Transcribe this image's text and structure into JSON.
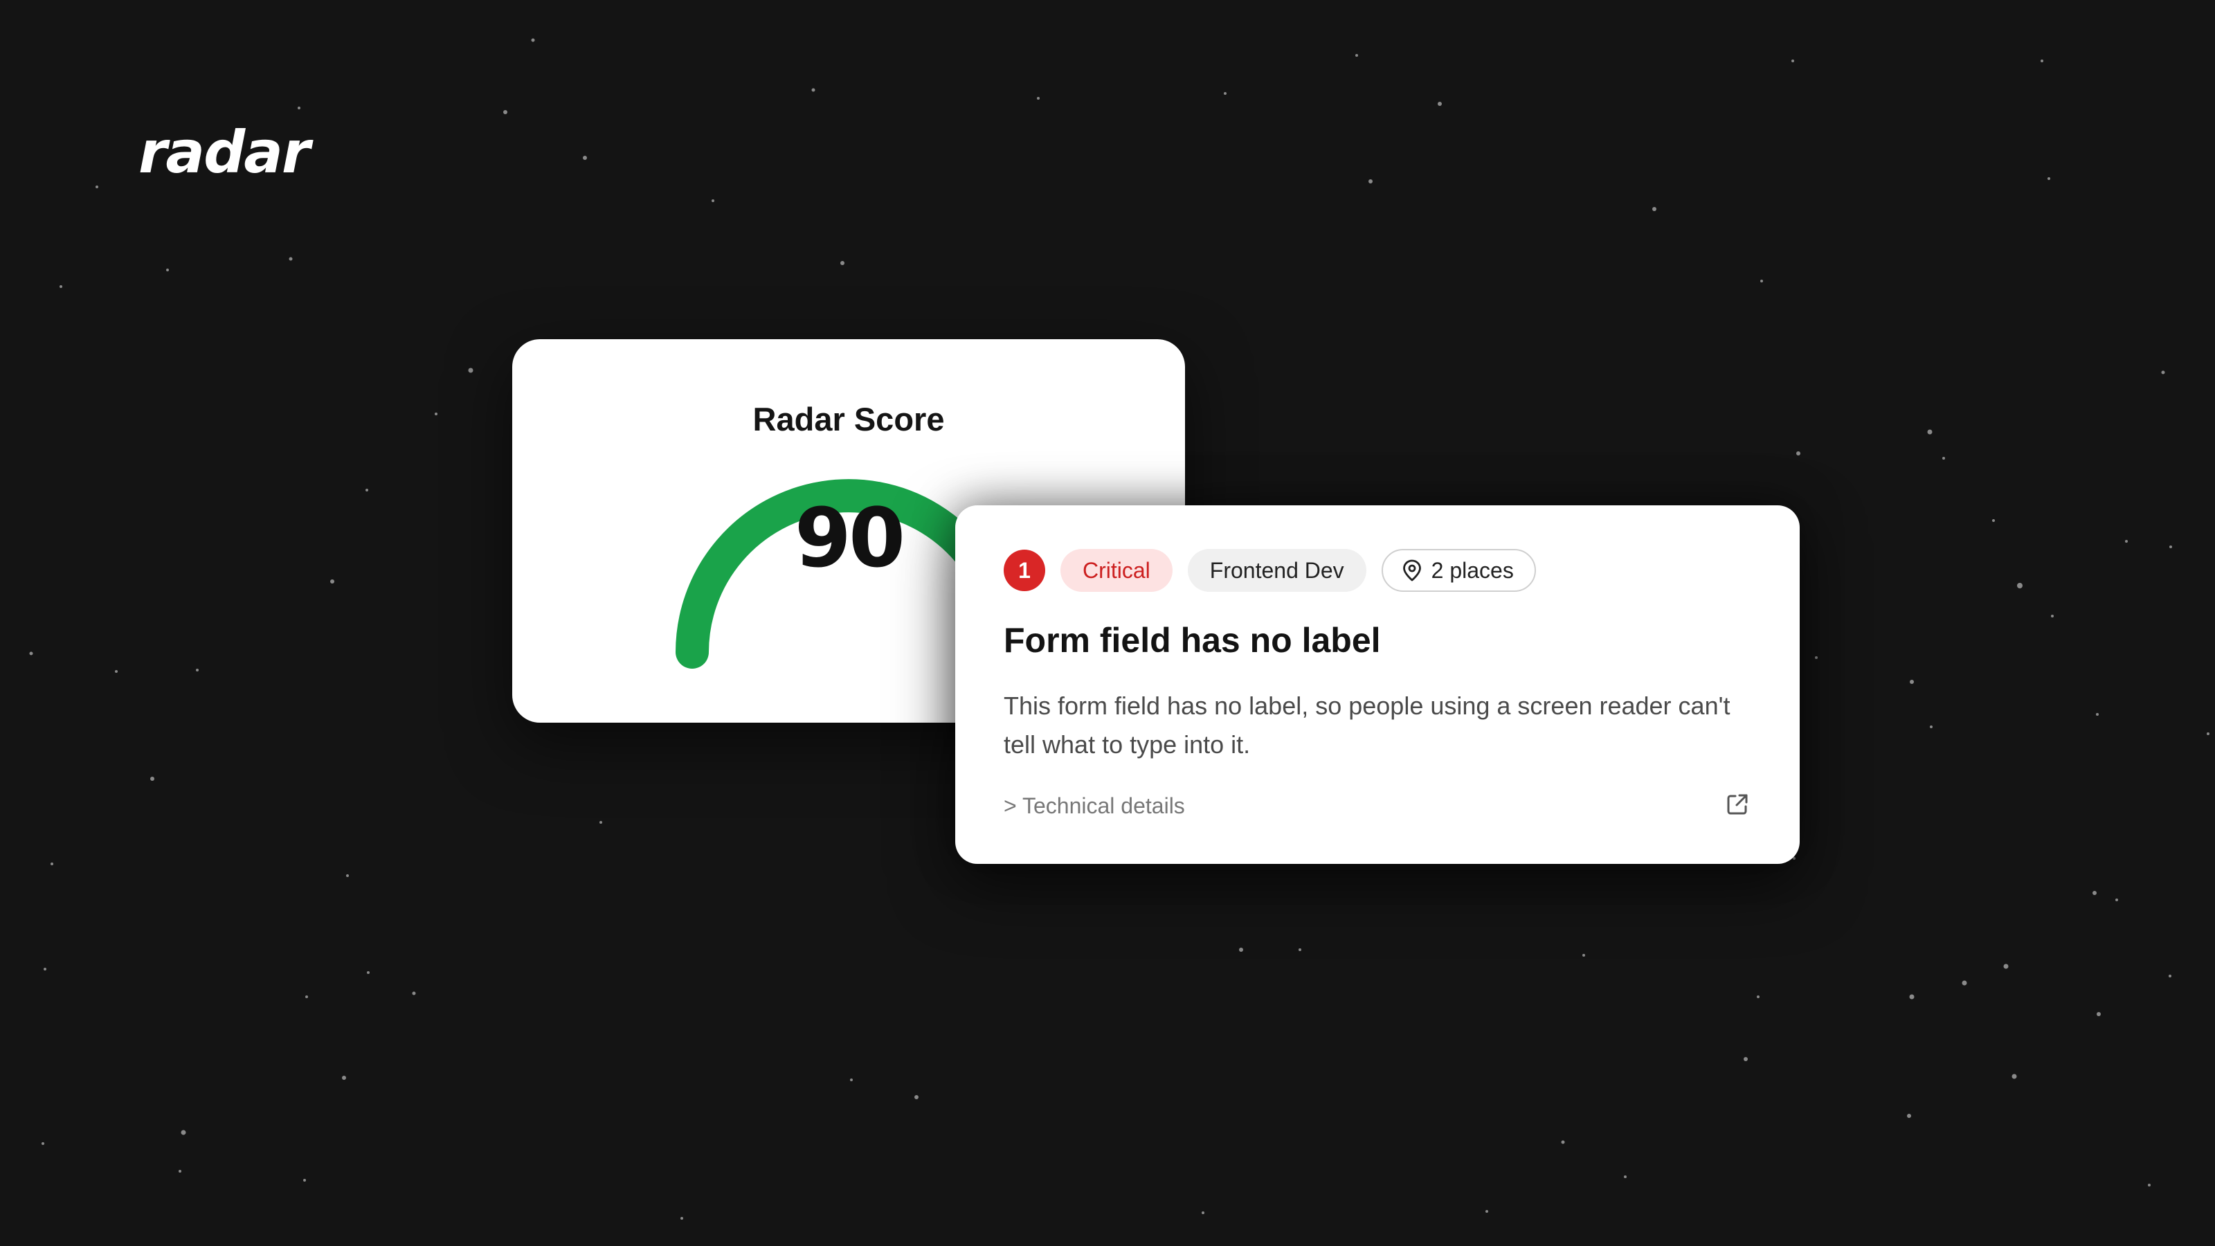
{
  "brand": {
    "logo_text": "radar"
  },
  "score_card": {
    "title": "Radar Score",
    "score": "90",
    "score_value": 90,
    "score_max": 100,
    "gauge_color": "#1aa34a"
  },
  "issue_card": {
    "count": "1",
    "severity": "Critical",
    "team": "Frontend Dev",
    "places": "2 places",
    "title": "Form field has no label",
    "description": "This form field has no label, so people using a screen reader can't tell what to type into it.",
    "details_link": "> Technical details",
    "icons": {
      "places": "map-pin-icon",
      "external": "external-link-icon"
    }
  },
  "colors": {
    "background": "#141414",
    "critical": "#d92626",
    "critical_bg": "#fde2e2"
  }
}
